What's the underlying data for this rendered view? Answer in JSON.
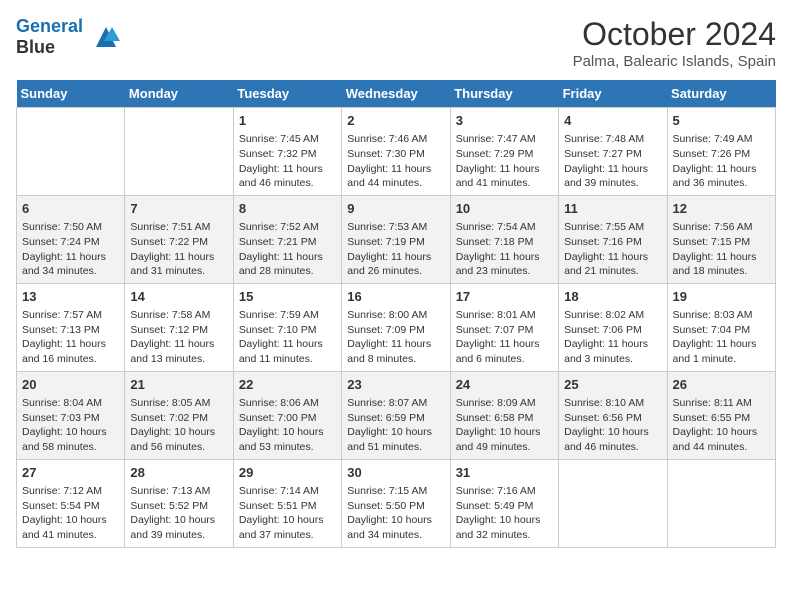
{
  "logo": {
    "line1": "General",
    "line2": "Blue"
  },
  "title": "October 2024",
  "subtitle": "Palma, Balearic Islands, Spain",
  "headers": [
    "Sunday",
    "Monday",
    "Tuesday",
    "Wednesday",
    "Thursday",
    "Friday",
    "Saturday"
  ],
  "weeks": [
    [
      {
        "day": "",
        "info": ""
      },
      {
        "day": "",
        "info": ""
      },
      {
        "day": "1",
        "info": "Sunrise: 7:45 AM\nSunset: 7:32 PM\nDaylight: 11 hours and 46 minutes."
      },
      {
        "day": "2",
        "info": "Sunrise: 7:46 AM\nSunset: 7:30 PM\nDaylight: 11 hours and 44 minutes."
      },
      {
        "day": "3",
        "info": "Sunrise: 7:47 AM\nSunset: 7:29 PM\nDaylight: 11 hours and 41 minutes."
      },
      {
        "day": "4",
        "info": "Sunrise: 7:48 AM\nSunset: 7:27 PM\nDaylight: 11 hours and 39 minutes."
      },
      {
        "day": "5",
        "info": "Sunrise: 7:49 AM\nSunset: 7:26 PM\nDaylight: 11 hours and 36 minutes."
      }
    ],
    [
      {
        "day": "6",
        "info": "Sunrise: 7:50 AM\nSunset: 7:24 PM\nDaylight: 11 hours and 34 minutes."
      },
      {
        "day": "7",
        "info": "Sunrise: 7:51 AM\nSunset: 7:22 PM\nDaylight: 11 hours and 31 minutes."
      },
      {
        "day": "8",
        "info": "Sunrise: 7:52 AM\nSunset: 7:21 PM\nDaylight: 11 hours and 28 minutes."
      },
      {
        "day": "9",
        "info": "Sunrise: 7:53 AM\nSunset: 7:19 PM\nDaylight: 11 hours and 26 minutes."
      },
      {
        "day": "10",
        "info": "Sunrise: 7:54 AM\nSunset: 7:18 PM\nDaylight: 11 hours and 23 minutes."
      },
      {
        "day": "11",
        "info": "Sunrise: 7:55 AM\nSunset: 7:16 PM\nDaylight: 11 hours and 21 minutes."
      },
      {
        "day": "12",
        "info": "Sunrise: 7:56 AM\nSunset: 7:15 PM\nDaylight: 11 hours and 18 minutes."
      }
    ],
    [
      {
        "day": "13",
        "info": "Sunrise: 7:57 AM\nSunset: 7:13 PM\nDaylight: 11 hours and 16 minutes."
      },
      {
        "day": "14",
        "info": "Sunrise: 7:58 AM\nSunset: 7:12 PM\nDaylight: 11 hours and 13 minutes."
      },
      {
        "day": "15",
        "info": "Sunrise: 7:59 AM\nSunset: 7:10 PM\nDaylight: 11 hours and 11 minutes."
      },
      {
        "day": "16",
        "info": "Sunrise: 8:00 AM\nSunset: 7:09 PM\nDaylight: 11 hours and 8 minutes."
      },
      {
        "day": "17",
        "info": "Sunrise: 8:01 AM\nSunset: 7:07 PM\nDaylight: 11 hours and 6 minutes."
      },
      {
        "day": "18",
        "info": "Sunrise: 8:02 AM\nSunset: 7:06 PM\nDaylight: 11 hours and 3 minutes."
      },
      {
        "day": "19",
        "info": "Sunrise: 8:03 AM\nSunset: 7:04 PM\nDaylight: 11 hours and 1 minute."
      }
    ],
    [
      {
        "day": "20",
        "info": "Sunrise: 8:04 AM\nSunset: 7:03 PM\nDaylight: 10 hours and 58 minutes."
      },
      {
        "day": "21",
        "info": "Sunrise: 8:05 AM\nSunset: 7:02 PM\nDaylight: 10 hours and 56 minutes."
      },
      {
        "day": "22",
        "info": "Sunrise: 8:06 AM\nSunset: 7:00 PM\nDaylight: 10 hours and 53 minutes."
      },
      {
        "day": "23",
        "info": "Sunrise: 8:07 AM\nSunset: 6:59 PM\nDaylight: 10 hours and 51 minutes."
      },
      {
        "day": "24",
        "info": "Sunrise: 8:09 AM\nSunset: 6:58 PM\nDaylight: 10 hours and 49 minutes."
      },
      {
        "day": "25",
        "info": "Sunrise: 8:10 AM\nSunset: 6:56 PM\nDaylight: 10 hours and 46 minutes."
      },
      {
        "day": "26",
        "info": "Sunrise: 8:11 AM\nSunset: 6:55 PM\nDaylight: 10 hours and 44 minutes."
      }
    ],
    [
      {
        "day": "27",
        "info": "Sunrise: 7:12 AM\nSunset: 5:54 PM\nDaylight: 10 hours and 41 minutes."
      },
      {
        "day": "28",
        "info": "Sunrise: 7:13 AM\nSunset: 5:52 PM\nDaylight: 10 hours and 39 minutes."
      },
      {
        "day": "29",
        "info": "Sunrise: 7:14 AM\nSunset: 5:51 PM\nDaylight: 10 hours and 37 minutes."
      },
      {
        "day": "30",
        "info": "Sunrise: 7:15 AM\nSunset: 5:50 PM\nDaylight: 10 hours and 34 minutes."
      },
      {
        "day": "31",
        "info": "Sunrise: 7:16 AM\nSunset: 5:49 PM\nDaylight: 10 hours and 32 minutes."
      },
      {
        "day": "",
        "info": ""
      },
      {
        "day": "",
        "info": ""
      }
    ]
  ]
}
